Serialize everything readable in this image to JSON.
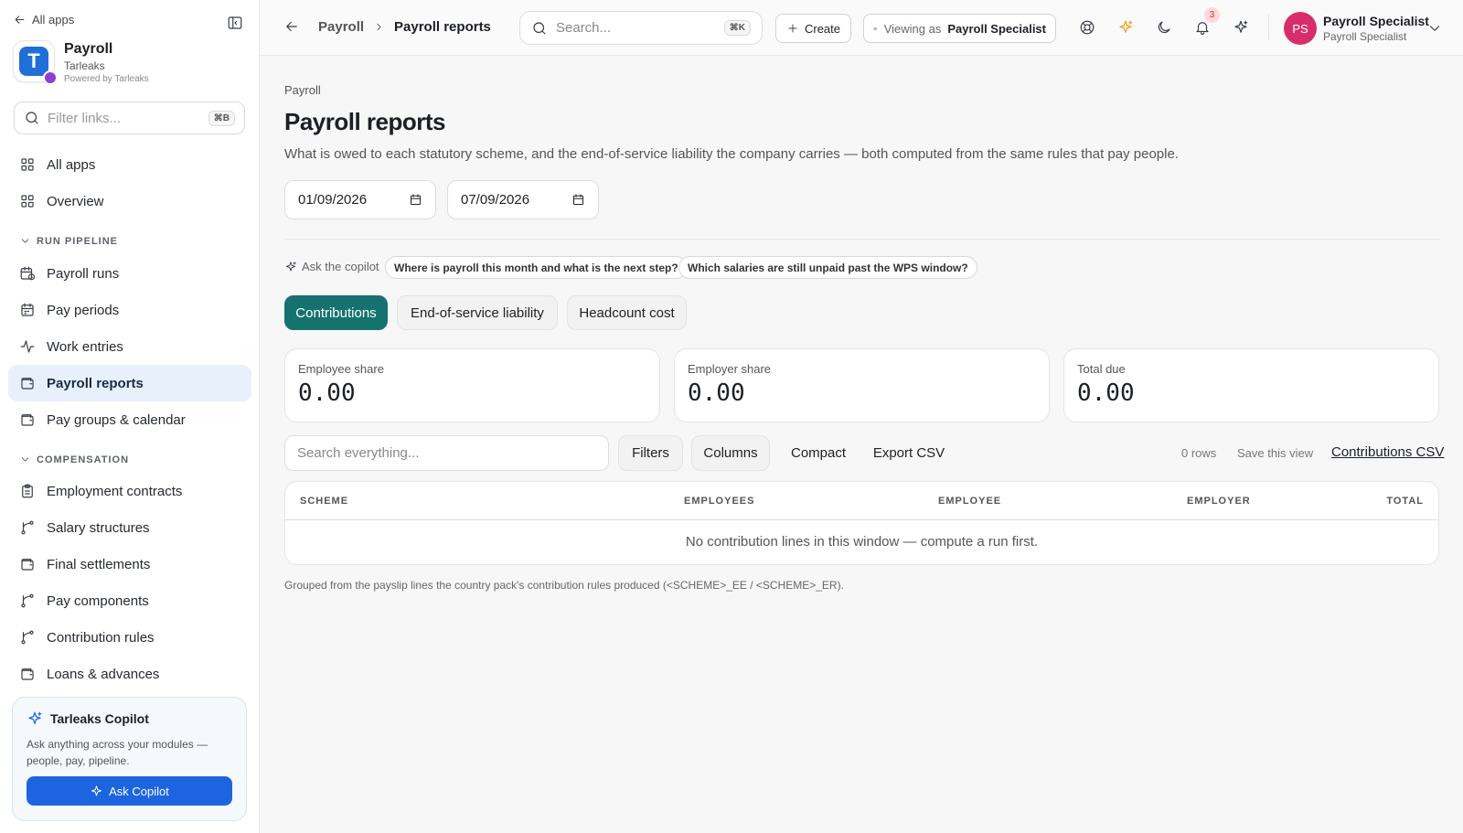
{
  "sidebar": {
    "all_apps_link": "All apps",
    "app": {
      "name": "Payroll",
      "org": "Tarleaks",
      "powered": "Powered by Tarleaks",
      "logo_letter": "T"
    },
    "filter": {
      "placeholder": "Filter links...",
      "shortcut": "⌘B"
    },
    "items": [
      {
        "label": "All apps",
        "icon": "grid-icon"
      },
      {
        "label": "Overview",
        "icon": "grid-icon"
      }
    ],
    "sections": [
      {
        "title": "RUN PIPELINE",
        "items": [
          {
            "label": "Payroll runs",
            "icon": "calendar-clock-icon"
          },
          {
            "label": "Pay periods",
            "icon": "calendar-icon"
          },
          {
            "label": "Work entries",
            "icon": "activity-icon"
          },
          {
            "label": "Payroll reports",
            "icon": "wallet-icon",
            "active": true
          },
          {
            "label": "Pay groups & calendar",
            "icon": "wallet-icon"
          }
        ]
      },
      {
        "title": "COMPENSATION",
        "items": [
          {
            "label": "Employment contracts",
            "icon": "clipboard-icon"
          },
          {
            "label": "Salary structures",
            "icon": "branch-icon"
          },
          {
            "label": "Final settlements",
            "icon": "wallet-icon"
          },
          {
            "label": "Pay components",
            "icon": "branch-icon"
          },
          {
            "label": "Contribution rules",
            "icon": "branch-icon"
          },
          {
            "label": "Loans & advances",
            "icon": "wallet-icon"
          }
        ]
      }
    ],
    "copilot": {
      "title": "Tarleaks Copilot",
      "description": "Ask anything across your modules — people, pay, pipeline.",
      "button": "Ask Copilot"
    }
  },
  "topbar": {
    "breadcrumb": [
      "Payroll",
      "Payroll reports"
    ],
    "search": {
      "placeholder": "Search...",
      "shortcut": "⌘K"
    },
    "create_label": "Create",
    "viewing_prefix": "Viewing as",
    "viewing_role": "Payroll Specialist",
    "notification_count": "3",
    "user": {
      "initials": "PS",
      "name": "Payroll Specialist",
      "role": "Payroll Specialist"
    },
    "colors": {
      "avatar": "#d92d6b",
      "accent_icon": "#f0a020"
    }
  },
  "page": {
    "crumb": "Payroll",
    "title": "Payroll reports",
    "description": "What is owed to each statutory scheme, and the end-of-service liability the company carries — both computed from the same rules that pay people.",
    "date_from": "01/09/2026",
    "date_to": "07/09/2026",
    "ask_label": "Ask the copilot",
    "suggestions": [
      "Where is payroll this month and what is the next step?",
      "Which salaries are still unpaid past the WPS window?"
    ],
    "tabs": [
      {
        "label": "Contributions",
        "active": true
      },
      {
        "label": "End-of-service liability"
      },
      {
        "label": "Headcount cost"
      }
    ],
    "kpis": [
      {
        "label": "Employee share",
        "value": "0.00"
      },
      {
        "label": "Employer share",
        "value": "0.00"
      },
      {
        "label": "Total due",
        "value": "0.00"
      }
    ],
    "toolbar": {
      "search_placeholder": "Search everything...",
      "filters": "Filters",
      "columns": "Columns",
      "compact": "Compact",
      "export": "Export CSV",
      "rows": "0 rows",
      "save_view": "Save this view",
      "csv_link": "Contributions CSV"
    },
    "table": {
      "columns": [
        "SCHEME",
        "EMPLOYEES",
        "EMPLOYEE",
        "EMPLOYER",
        "TOTAL"
      ],
      "empty_message": "No contribution lines in this window — compute a run first."
    },
    "footnote": "Grouped from the payslip lines the country pack's contribution rules produced (<SCHEME>_EE / <SCHEME>_ER).",
    "colors": {
      "active_tab": "#16726f",
      "active_nav": "#e8f0fb",
      "copilot_button": "#1d64e0"
    }
  }
}
